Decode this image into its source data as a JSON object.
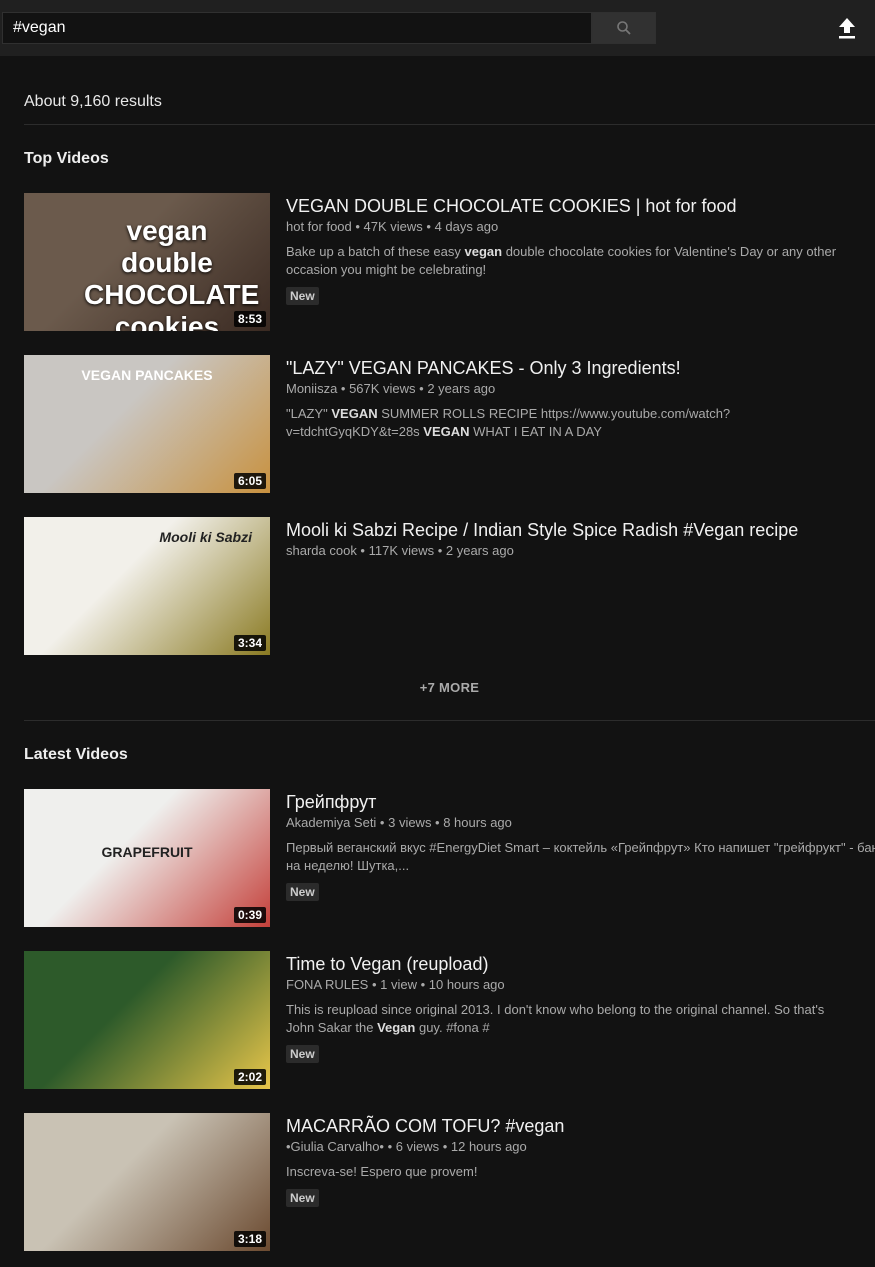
{
  "header": {
    "search_value": "#vegan",
    "search_icon": "search-icon",
    "upload_icon": "upload-icon"
  },
  "results_count": "About 9,160 results",
  "sections": [
    {
      "title": "Top Videos",
      "videos": [
        {
          "title": "VEGAN DOUBLE CHOCOLATE COOKIES | hot for food",
          "meta": "hot for food • 47K views • 4 days ago",
          "description": [
            {
              "t": "Bake up a batch of these easy "
            },
            {
              "t": "vegan",
              "b": true
            },
            {
              "t": " double chocolate cookies for Valentine's Day or any other occasion you might be celebrating!"
            }
          ],
          "badge": "New",
          "duration": "8:53",
          "thumbnail_text": "vegan double CHOCOLATE cookies",
          "thumb_colors": [
            "#6b5a4c",
            "#3a2a22"
          ]
        },
        {
          "title": "\"LAZY\" VEGAN PANCAKES - Only 3 Ingredients!",
          "meta": "Moniisza • 567K views • 2 years ago",
          "description": [
            {
              "t": "\"LAZY\" "
            },
            {
              "t": "VEGAN",
              "b": true
            },
            {
              "t": " SUMMER ROLLS RECIPE https://www.youtube.com/watch?v=tdchtGyqKDY&t=28s "
            },
            {
              "t": "VEGAN",
              "b": true
            },
            {
              "t": " WHAT I EAT IN A DAY"
            }
          ],
          "duration": "6:05",
          "thumbnail_text": "VEGAN PANCAKES",
          "thumb_colors": [
            "#c9c6c2",
            "#c8913f"
          ]
        },
        {
          "title": "Mooli ki Sabzi Recipe / Indian Style Spice Radish #Vegan recipe",
          "meta": "sharda cook • 117K views • 2 years ago",
          "description": [],
          "duration": "3:34",
          "thumbnail_text": "Mooli ki Sabzi",
          "thumb_colors": [
            "#f2f0ea",
            "#8a7a22"
          ]
        }
      ],
      "more_label": "+7 MORE"
    },
    {
      "title": "Latest Videos",
      "videos": [
        {
          "title": "Грейпфрут",
          "meta": "Akademiya Seti • 3 views • 8 hours ago",
          "description": [
            {
              "t": "Первый веганский вкус #EnergyDiet Smart – коктейль «Грейпфрут» Кто напишет \"грейфрукт\" - банка на неделю! Шутка,..."
            }
          ],
          "badge": "New",
          "duration": "0:39",
          "thumbnail_text": "GRAPEFRUIT",
          "thumb_colors": [
            "#efefed",
            "#c4403a"
          ]
        },
        {
          "title": "Time to Vegan (reupload)",
          "meta": "FONA RULES • 1 view • 10 hours ago",
          "description": [
            {
              "t": "This is reupload since original 2013. I don't know who belong to the original channel. So that's John Sakar the "
            },
            {
              "t": "Vegan",
              "b": true
            },
            {
              "t": " guy. #fona #"
            }
          ],
          "badge": "New",
          "duration": "2:02",
          "thumbnail_text": "",
          "thumb_colors": [
            "#2d5a2a",
            "#e8c64a"
          ]
        },
        {
          "title": "MACARRÃO COM TOFU? #vegan",
          "meta": "•Giulia Carvalho• • 6 views • 12 hours ago",
          "description": [
            {
              "t": "Inscreva-se! Espero que provem!"
            }
          ],
          "badge": "New",
          "duration": "3:18",
          "thumbnail_text": "",
          "thumb_colors": [
            "#c9c2b4",
            "#6b4a30"
          ]
        }
      ]
    }
  ]
}
